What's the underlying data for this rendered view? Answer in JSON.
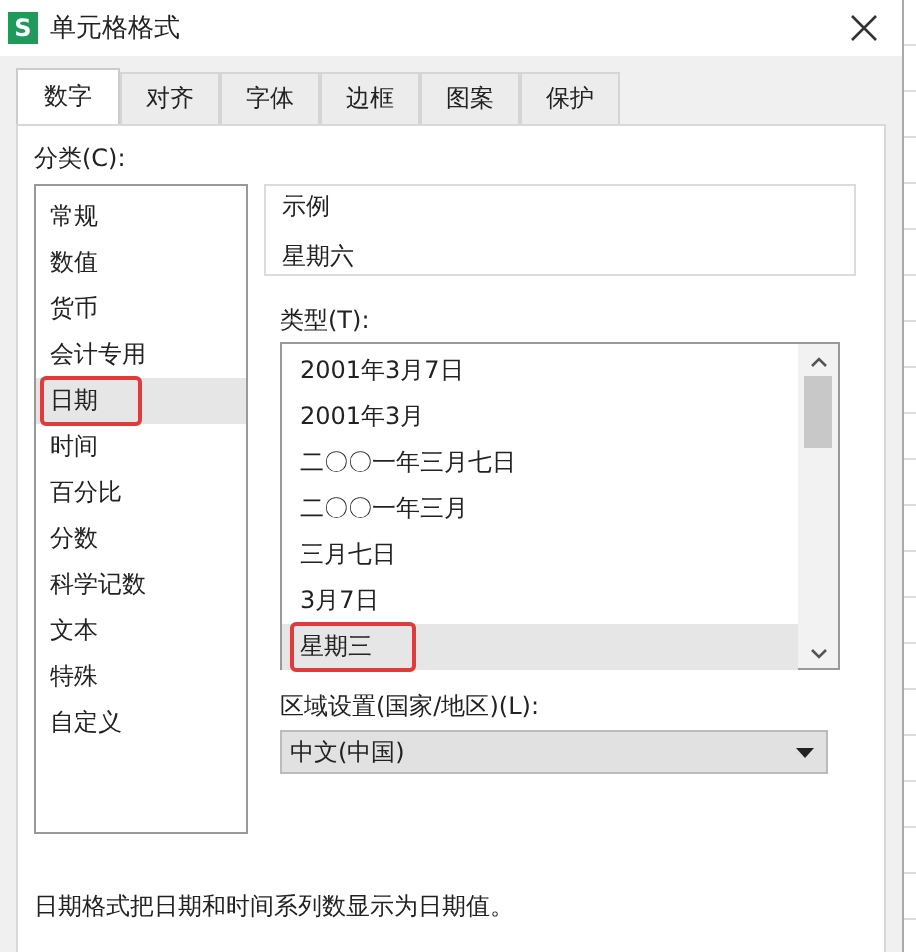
{
  "window": {
    "title": "单元格格式",
    "app_icon": "S"
  },
  "tabs": [
    {
      "label": "数字",
      "selected": true
    },
    {
      "label": "对齐",
      "selected": false
    },
    {
      "label": "字体",
      "selected": false
    },
    {
      "label": "边框",
      "selected": false
    },
    {
      "label": "图案",
      "selected": false
    },
    {
      "label": "保护",
      "selected": false
    }
  ],
  "category": {
    "label": "分类(C):",
    "items": [
      {
        "label": "常规",
        "selected": false,
        "annotated": false
      },
      {
        "label": "数值",
        "selected": false,
        "annotated": false
      },
      {
        "label": "货币",
        "selected": false,
        "annotated": false
      },
      {
        "label": "会计专用",
        "selected": false,
        "annotated": false
      },
      {
        "label": "日期",
        "selected": true,
        "annotated": true
      },
      {
        "label": "时间",
        "selected": false,
        "annotated": false
      },
      {
        "label": "百分比",
        "selected": false,
        "annotated": false
      },
      {
        "label": "分数",
        "selected": false,
        "annotated": false
      },
      {
        "label": "科学记数",
        "selected": false,
        "annotated": false
      },
      {
        "label": "文本",
        "selected": false,
        "annotated": false
      },
      {
        "label": "特殊",
        "selected": false,
        "annotated": false
      },
      {
        "label": "自定义",
        "selected": false,
        "annotated": false
      }
    ]
  },
  "sample": {
    "label": "示例",
    "value": "星期六"
  },
  "type": {
    "label": "类型(T):",
    "items": [
      {
        "label": "2001年3月7日",
        "selected": false,
        "annotated": false
      },
      {
        "label": "2001年3月",
        "selected": false,
        "annotated": false
      },
      {
        "label": "二〇〇一年三月七日",
        "selected": false,
        "annotated": false
      },
      {
        "label": "二〇〇一年三月",
        "selected": false,
        "annotated": false
      },
      {
        "label": "三月七日",
        "selected": false,
        "annotated": false
      },
      {
        "label": "3月7日",
        "selected": false,
        "annotated": false
      },
      {
        "label": "星期三",
        "selected": true,
        "annotated": true
      }
    ]
  },
  "locale": {
    "label": "区域设置(国家/地区)(L):",
    "value": "中文(中国)"
  },
  "description": "日期格式把日期和时间系列数显示为日期值。"
}
